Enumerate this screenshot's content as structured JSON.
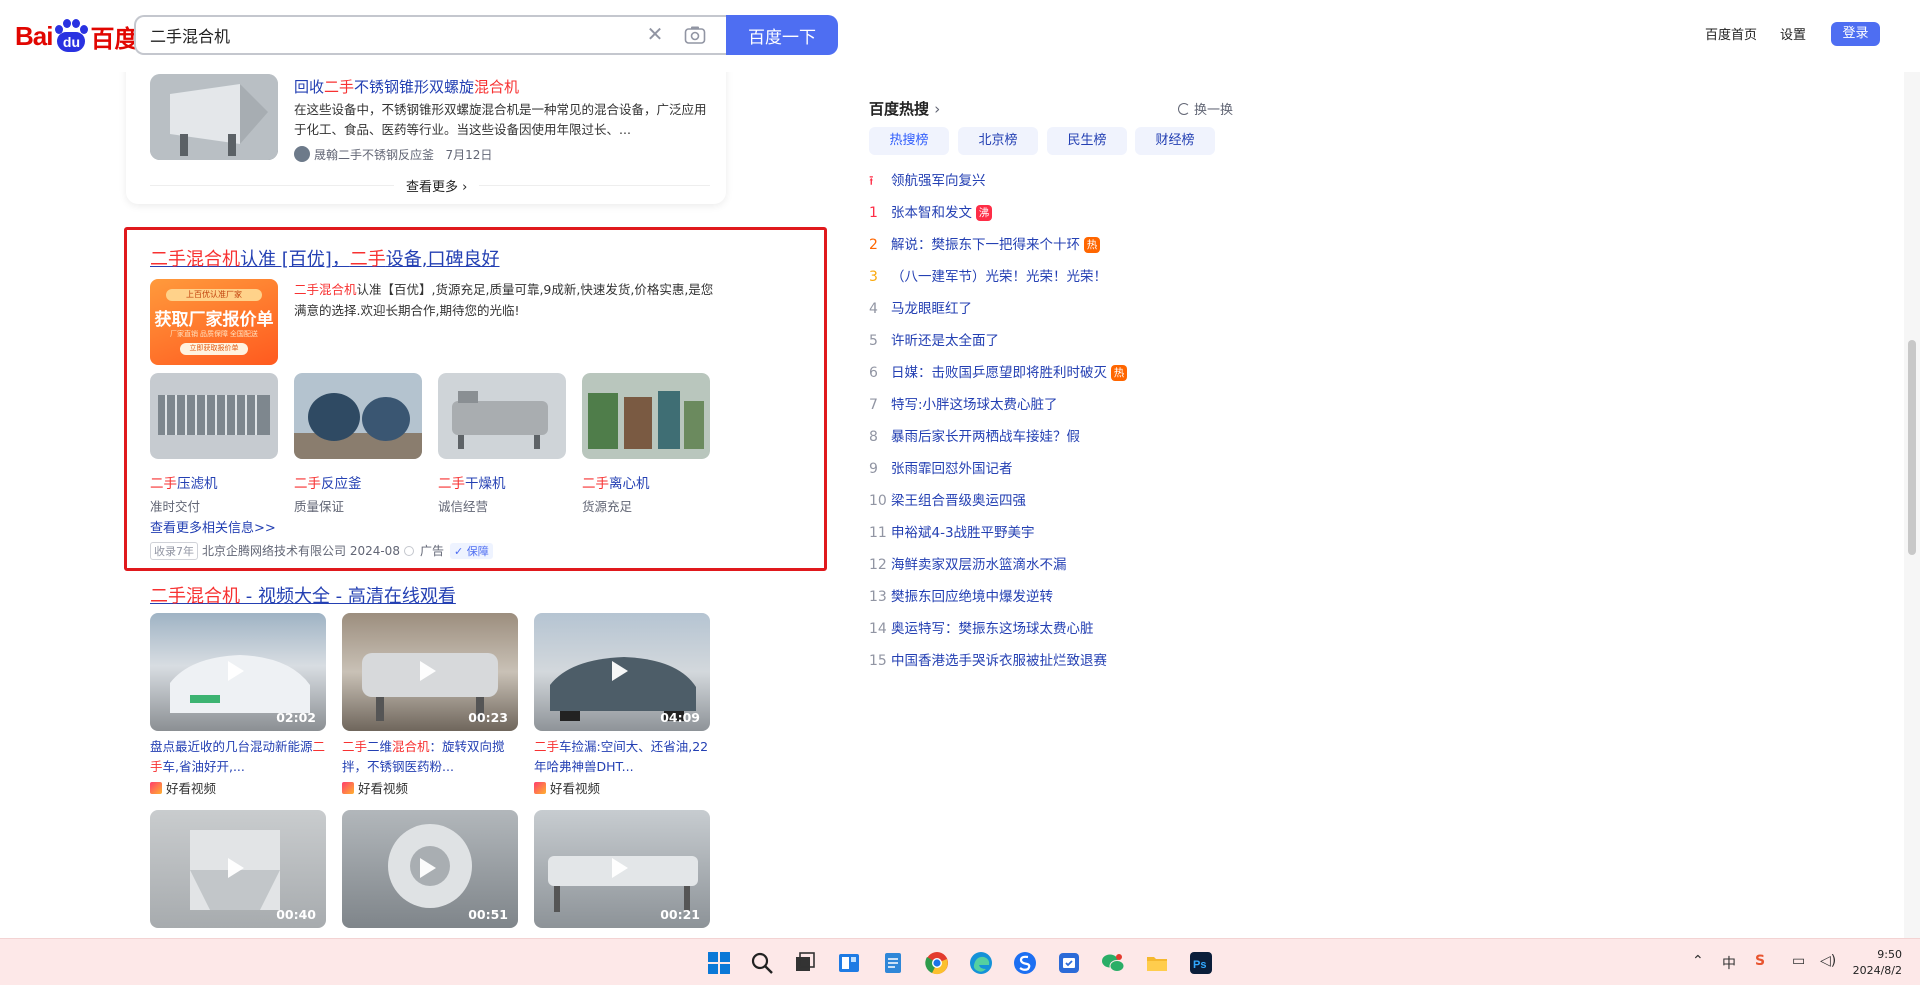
{
  "header": {
    "logo_text_1": "Bai",
    "logo_text_2": "du",
    "logo_text_3": "百度",
    "search_value": "二手混合机",
    "search_button": "百度一下",
    "links": [
      "百度首页",
      "设置"
    ],
    "login": "登录"
  },
  "card1": {
    "title_pre": "回收",
    "title_hl1": "二手",
    "title_mid": "不锈钢锥形双螺旋",
    "title_hl2": "混合机",
    "desc": "在这些设备中，不锈钢锥形双螺旋混合机是一种常见的混合设备，广泛应用于化工、食品、医药等行业。当这些设备因使用年限过长、...",
    "source": "晟翰二手不锈钢反应釜",
    "date": "7月12日",
    "more": "查看更多"
  },
  "ad": {
    "title_hl1": "二手混合机",
    "title_mid": "认准 [百优]，",
    "title_hl2": "二手",
    "title_end": "设备,口碑良好",
    "banner_top": "上百优认准厂家",
    "banner_main": "获取厂家报价单",
    "banner_sub": "厂家直销 品质保障 全国配送",
    "banner_btn": "立即获取报价单",
    "desc_hl": "二手混合机",
    "desc": "认准【百优】,货源充足,质量可靠,9成新,快速发货,价格实惠,是您满意的选择.欢迎长期合作,期待您的光临!",
    "products": [
      {
        "hl": "二手",
        "name": "压滤机",
        "tag": "准时交付"
      },
      {
        "hl": "二手",
        "name": "反应釜",
        "tag": "质量保证"
      },
      {
        "hl": "二手",
        "name": "干燥机",
        "tag": "诚信经营"
      },
      {
        "hl": "二手",
        "name": "离心机",
        "tag": "货源充足"
      }
    ],
    "more": "查看更多相关信息>>",
    "badge": "收录7年",
    "company": "北京企腾网络技术有限公司 2024-08",
    "ad_label": "广告",
    "guarantee": "保障"
  },
  "videos": {
    "title_hl": "二手混合机",
    "title_rest": " - 视频大全 - 高清在线观看",
    "items": [
      {
        "duration": "02:02",
        "cap_a": "盘点最近收的几台混动新能源",
        "cap_hl": "二手",
        "cap_b": "车,省油好开,...",
        "source": "好看视频"
      },
      {
        "duration": "00:23",
        "cap_hl": "二手",
        "cap_a2": "二维",
        "cap_hl2": "混合机",
        "cap_b": "：旋转双向搅拌，不锈钢医药粉...",
        "source": "好看视频"
      },
      {
        "duration": "04:09",
        "cap_hl": "二手",
        "cap_b": "车捡漏:空间大、还省油,22年哈弗神兽DHT...",
        "source": "好看视频"
      },
      {
        "duration": "00:40"
      },
      {
        "duration": "00:51"
      },
      {
        "duration": "00:21"
      }
    ]
  },
  "hot": {
    "title": "百度热搜",
    "refresh": "换一换",
    "tabs": [
      "热搜榜",
      "北京榜",
      "民生榜",
      "财经榜"
    ],
    "pinned": "领航强军向复兴",
    "items": [
      {
        "rank": "1",
        "text": "张本智和发文",
        "tag": "沸",
        "tag_color": "#fe2d46"
      },
      {
        "rank": "2",
        "text": "解说：樊振东下一把得来个十环",
        "tag": "热",
        "tag_color": "#ff6600"
      },
      {
        "rank": "3",
        "text": "（八一建军节）光荣！光荣！光荣！"
      },
      {
        "rank": "4",
        "text": "马龙眼眶红了"
      },
      {
        "rank": "5",
        "text": "许昕还是太全面了"
      },
      {
        "rank": "6",
        "text": "日媒：击败国乒愿望即将胜利时破灭",
        "tag": "热",
        "tag_color": "#ff6600"
      },
      {
        "rank": "7",
        "text": "特写:小胖这场球太费心脏了"
      },
      {
        "rank": "8",
        "text": "暴雨后家长开两栖战车接娃？假"
      },
      {
        "rank": "9",
        "text": "张雨霏回怼外国记者"
      },
      {
        "rank": "10",
        "text": "梁王组合晋级奥运四强"
      },
      {
        "rank": "11",
        "text": "申裕斌4-3战胜平野美宇"
      },
      {
        "rank": "12",
        "text": "海鲜卖家双层沥水篮滴水不漏"
      },
      {
        "rank": "13",
        "text": "樊振东回应绝境中爆发逆转"
      },
      {
        "rank": "14",
        "text": "奥运特写：樊振东这场球太费心脏"
      },
      {
        "rank": "15",
        "text": "中国香港选手哭诉衣服被扯烂致退赛"
      }
    ]
  },
  "taskbar": {
    "tray_lang": "中",
    "time": "9:50",
    "date": "2024/8/2"
  }
}
